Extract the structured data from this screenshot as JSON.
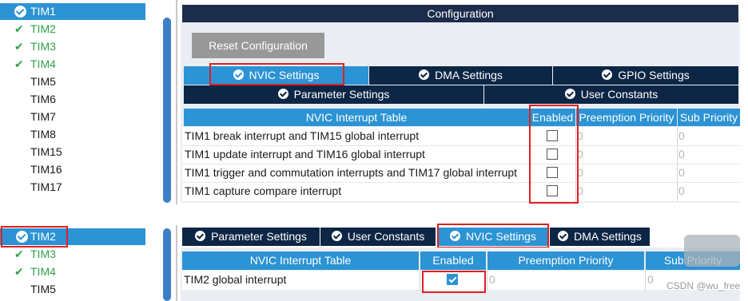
{
  "top_list": [
    {
      "label": "TIM1",
      "state": "selected"
    },
    {
      "label": "TIM2",
      "state": "checked"
    },
    {
      "label": "TIM3",
      "state": "checked"
    },
    {
      "label": "TIM4",
      "state": "checked"
    },
    {
      "label": "TIM5",
      "state": "none"
    },
    {
      "label": "TIM6",
      "state": "none"
    },
    {
      "label": "TIM7",
      "state": "none"
    },
    {
      "label": "TIM8",
      "state": "none"
    },
    {
      "label": "TIM15",
      "state": "none"
    },
    {
      "label": "TIM16",
      "state": "none"
    },
    {
      "label": "TIM17",
      "state": "none"
    }
  ],
  "bottom_list": [
    {
      "label": "TIM2",
      "state": "selected"
    },
    {
      "label": "TIM3",
      "state": "checked"
    },
    {
      "label": "TIM4",
      "state": "checked"
    },
    {
      "label": "TIM5",
      "state": "none"
    }
  ],
  "config": {
    "title": "Configuration",
    "reset_label": "Reset Configuration",
    "tabs_row1": [
      "NVIC Settings",
      "DMA Settings",
      "GPIO Settings"
    ],
    "tabs_row2": [
      "Parameter Settings",
      "User Constants"
    ],
    "table_headers": [
      "NVIC Interrupt Table",
      "Enabled",
      "Preemption Priority",
      "Sub Priority"
    ],
    "rows": [
      {
        "name": "TIM1 break interrupt and TIM15 global interrupt",
        "enabled": false,
        "preemption": "0",
        "sub": "0"
      },
      {
        "name": "TIM1 update interrupt and TIM16 global interrupt",
        "enabled": false,
        "preemption": "0",
        "sub": "0"
      },
      {
        "name": "TIM1 trigger and commutation interrupts and TIM17 global interrupt",
        "enabled": false,
        "preemption": "0",
        "sub": "0"
      },
      {
        "name": "TIM1 capture compare interrupt",
        "enabled": false,
        "preemption": "0",
        "sub": "0"
      }
    ]
  },
  "config2": {
    "tabs": [
      "Parameter Settings",
      "User Constants",
      "NVIC Settings",
      "DMA Settings"
    ],
    "table_headers": [
      "NVIC Interrupt Table",
      "Enabled",
      "Preemption Priority",
      "Sub Priority"
    ],
    "rows": [
      {
        "name": "TIM2 global interrupt",
        "enabled": true,
        "preemption": "0",
        "sub": "0"
      }
    ]
  },
  "watermark": "CSDN @wu_free",
  "colors": {
    "accent": "#2c93d4",
    "dark_tab": "#0d2645",
    "header": "#1b2d4b",
    "highlight": "#e02020",
    "check_green": "#2fa14a"
  }
}
